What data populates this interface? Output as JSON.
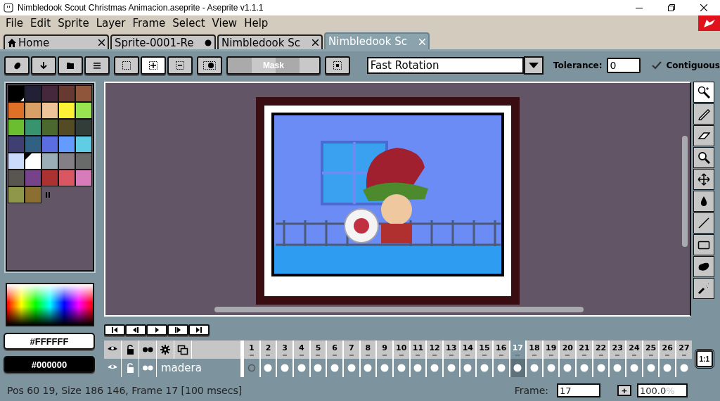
{
  "window": {
    "title": "Nimbledook Scout Christmas Animacion.aseprite - Aseprite v1.1.1"
  },
  "menu": [
    "File",
    "Edit",
    "Sprite",
    "Layer",
    "Frame",
    "Select",
    "View",
    "Help"
  ],
  "tabs": [
    {
      "label": "Home",
      "kind": "home",
      "modified": false,
      "selected": false
    },
    {
      "label": "Sprite-0001-Re",
      "kind": "document",
      "modified": true,
      "selected": false
    },
    {
      "label": "Nimbledook  Sc",
      "kind": "document",
      "modified": false,
      "selected": false
    },
    {
      "label": "Nimbledook  Sc",
      "kind": "document",
      "modified": false,
      "selected": true
    }
  ],
  "toolbar": {
    "selection_modes": [
      {
        "selected": false
      },
      {
        "selected": true
      },
      {
        "selected": false
      }
    ],
    "mask_button": "Mask",
    "rotation": "Fast Rotation",
    "tolerance_label": "Tolerance:",
    "tolerance": "0",
    "contiguous": {
      "label": "Contiguous",
      "checked": true
    }
  },
  "palette": [
    {
      "color": "#000000",
      "foreground": false,
      "background": true
    },
    {
      "color": "#222034",
      "foreground": false,
      "background": false
    },
    {
      "color": "#45283c",
      "foreground": false,
      "background": false
    },
    {
      "color": "#663931",
      "foreground": false,
      "background": false
    },
    {
      "color": "#8f563b",
      "foreground": false,
      "background": false
    },
    {
      "color": "#df7126",
      "foreground": false,
      "background": false
    },
    {
      "color": "#d9a066",
      "foreground": false,
      "background": false
    },
    {
      "color": "#eec39a",
      "foreground": false,
      "background": false
    },
    {
      "color": "#fbf236",
      "foreground": false,
      "background": false
    },
    {
      "color": "#99e550",
      "foreground": false,
      "background": false
    },
    {
      "color": "#6abe30",
      "foreground": false,
      "background": false
    },
    {
      "color": "#37946e",
      "foreground": false,
      "background": false
    },
    {
      "color": "#4b692f",
      "foreground": false,
      "background": false
    },
    {
      "color": "#524b24",
      "foreground": false,
      "background": false
    },
    {
      "color": "#323c39",
      "foreground": false,
      "background": false
    },
    {
      "color": "#3f3f74",
      "foreground": false,
      "background": false
    },
    {
      "color": "#306082",
      "foreground": false,
      "background": false
    },
    {
      "color": "#5b6ee1",
      "foreground": false,
      "background": false
    },
    {
      "color": "#639bff",
      "foreground": false,
      "background": false
    },
    {
      "color": "#5fcde4",
      "foreground": false,
      "background": false
    },
    {
      "color": "#cbdbfc",
      "foreground": false,
      "background": false
    },
    {
      "color": "#ffffff",
      "foreground": true,
      "background": false
    },
    {
      "color": "#9badb7",
      "foreground": false,
      "background": false
    },
    {
      "color": "#847e87",
      "foreground": false,
      "background": false
    },
    {
      "color": "#696a6a",
      "foreground": false,
      "background": false
    },
    {
      "color": "#595652",
      "foreground": false,
      "background": false
    },
    {
      "color": "#76428a",
      "foreground": false,
      "background": false
    },
    {
      "color": "#ac3232",
      "foreground": false,
      "background": false
    },
    {
      "color": "#d95763",
      "foreground": false,
      "background": false
    },
    {
      "color": "#d77bba",
      "foreground": false,
      "background": false
    },
    {
      "color": "#8f974a",
      "foreground": false,
      "background": false
    },
    {
      "color": "#8a6f30",
      "foreground": false,
      "background": false
    }
  ],
  "foreground_color": "#FFFFFF",
  "background_color": "#000000",
  "tools": [
    {
      "selected": true
    },
    {
      "selected": false
    },
    {
      "selected": false
    },
    {
      "selected": false
    },
    {
      "selected": false
    },
    {
      "selected": false
    },
    {
      "selected": false
    },
    {
      "selected": false
    },
    {
      "selected": false
    },
    {
      "selected": false
    }
  ],
  "timeline": {
    "layers": [
      {
        "name": "madera"
      }
    ],
    "frames": [
      {
        "label": "1",
        "cel_filled": false,
        "selected": false
      },
      {
        "label": "2",
        "cel_filled": true,
        "selected": false
      },
      {
        "label": "3",
        "cel_filled": true,
        "selected": false
      },
      {
        "label": "4",
        "cel_filled": true,
        "selected": false
      },
      {
        "label": "5",
        "cel_filled": true,
        "selected": false
      },
      {
        "label": "6",
        "cel_filled": true,
        "selected": false
      },
      {
        "label": "7",
        "cel_filled": true,
        "selected": false
      },
      {
        "label": "8",
        "cel_filled": true,
        "selected": false
      },
      {
        "label": "9",
        "cel_filled": true,
        "selected": false
      },
      {
        "label": "10",
        "cel_filled": true,
        "selected": false
      },
      {
        "label": "11",
        "cel_filled": true,
        "selected": false
      },
      {
        "label": "12",
        "cel_filled": true,
        "selected": false
      },
      {
        "label": "13",
        "cel_filled": true,
        "selected": false
      },
      {
        "label": "14",
        "cel_filled": true,
        "selected": false
      },
      {
        "label": "15",
        "cel_filled": true,
        "selected": false
      },
      {
        "label": "16",
        "cel_filled": true,
        "selected": false
      },
      {
        "label": "17",
        "cel_filled": true,
        "selected": true
      },
      {
        "label": "18",
        "cel_filled": true,
        "selected": false
      },
      {
        "label": "19",
        "cel_filled": true,
        "selected": false
      },
      {
        "label": "20",
        "cel_filled": true,
        "selected": false
      },
      {
        "label": "21",
        "cel_filled": true,
        "selected": false
      },
      {
        "label": "22",
        "cel_filled": true,
        "selected": false
      },
      {
        "label": "23",
        "cel_filled": true,
        "selected": false
      },
      {
        "label": "24",
        "cel_filled": true,
        "selected": false
      },
      {
        "label": "25",
        "cel_filled": true,
        "selected": false
      },
      {
        "label": "26",
        "cel_filled": true,
        "selected": false
      },
      {
        "label": "27",
        "cel_filled": true,
        "selected": false
      }
    ],
    "ratio_button": "1:1"
  },
  "status_bar": {
    "text": "Pos 60 19, Size 186 146, Frame 17 [100 msecs]",
    "frame_label": "Frame:",
    "frame": "17",
    "add_button": "+",
    "zoom": "100.0",
    "zoom_unit": "%"
  }
}
